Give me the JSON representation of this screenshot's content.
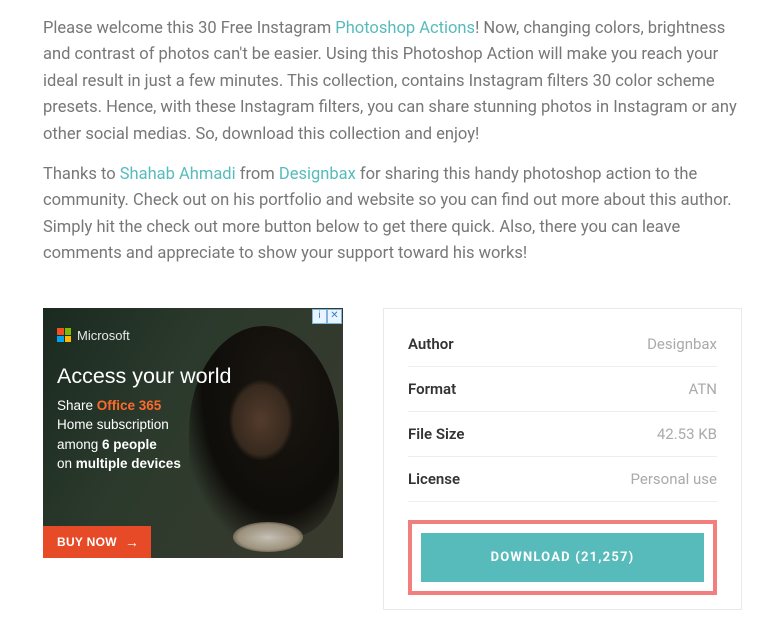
{
  "intro": {
    "p1": {
      "t1": "Please welcome this 30 Free Instagram ",
      "link1": "Photoshop Actions",
      "t2": "! Now, changing colors, brightness and contrast of photos can't be easier. Using this Photoshop Action will make you reach your ideal result in just a few minutes. This collection, contains Instagram filters 30 color scheme presets. Hence, with these Instagram filters, you can share stunning photos in Instagram or any other social medias. So, download this collection and enjoy!"
    },
    "p2": {
      "t1": "Thanks to ",
      "link1": "Shahab Ahmadi",
      "t2": " from ",
      "link2": "Designbax",
      "t3": " for sharing this handy photoshop action to the community. Check out on his portfolio and website so you can find out more about this author. Simply hit the check out more button below to get there quick. Also, there you can leave comments and appreciate to show your support toward his works!"
    }
  },
  "ad": {
    "info_icon": "i",
    "close_icon": "✕",
    "brand": "Microsoft",
    "headline": "Access your world",
    "line1a": "Share ",
    "line1b": "Office 365",
    "line2": "Home subscription",
    "line3a": "among ",
    "line3b": "6 people",
    "line4a": "on ",
    "line4b": "multiple devices",
    "cta": "BUY NOW",
    "arrow": "→"
  },
  "info": {
    "rows": [
      {
        "label": "Author",
        "value": "Designbax"
      },
      {
        "label": "Format",
        "value": "ATN"
      },
      {
        "label": "File Size",
        "value": "42.53 KB"
      },
      {
        "label": "License",
        "value": "Personal use"
      }
    ],
    "download": "DOWNLOAD (21,257)"
  }
}
